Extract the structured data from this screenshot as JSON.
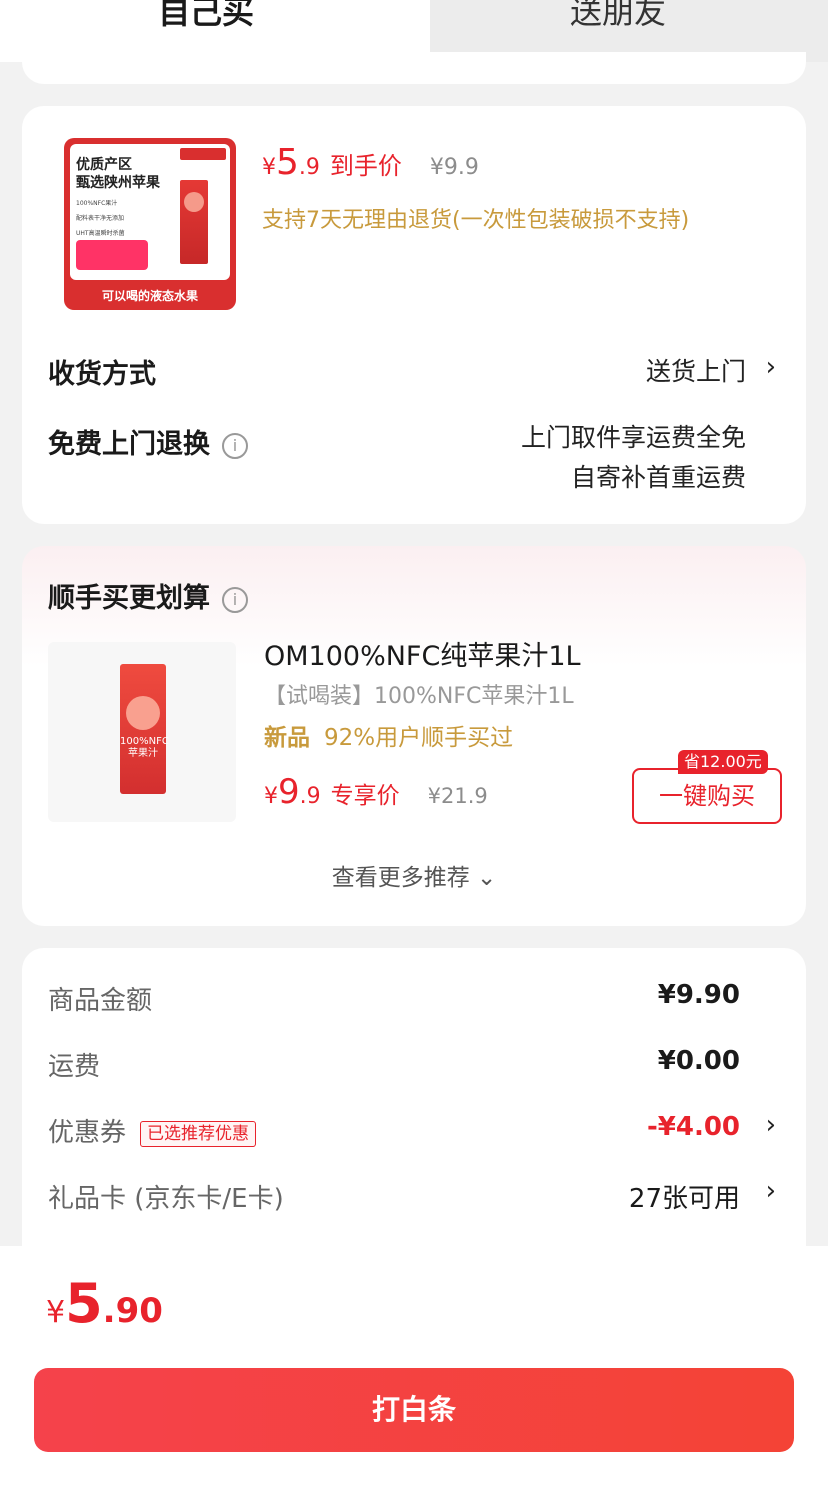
{
  "tabs": {
    "self": "自己买",
    "gift": "送朋友"
  },
  "product": {
    "thumb_title_1": "优质产区",
    "thumb_title_2": "甄选陕州苹果",
    "thumb_list": [
      "100%NFC果汁",
      "配料表干净无添加",
      "UHT高温瞬时杀菌"
    ],
    "thumb_caption": "可以喝的液态水果",
    "price_yen": "¥",
    "price_int": "5",
    "price_dec": ".9",
    "price_tag": "到手价",
    "orig_price": "¥9.9",
    "return_note": "支持7天无理由退货(一次性包装破损不支持)"
  },
  "delivery": {
    "label": "收货方式",
    "value": "送货上门"
  },
  "exchange": {
    "label": "免费上门退换",
    "line1": "上门取件享运费全免",
    "line2": "自寄补首重运费"
  },
  "recommend": {
    "title": "顺手买更划算",
    "name": "OM100%NFC纯苹果汁1L",
    "sub": "【试喝装】100%NFC苹果汁1L",
    "new_tag": "新品",
    "stat": "92%用户顺手买过",
    "price_yen": "¥",
    "price_int": "9",
    "price_dec": ".9",
    "price_tag": "专享价",
    "orig_price": "¥21.9",
    "save_badge": "省12.00元",
    "buy_label": "一键购买",
    "more": "查看更多推荐",
    "box_text": "100%NFC 苹果汁"
  },
  "summary": {
    "goods_label": "商品金额",
    "goods_value": "¥9.90",
    "shipping_label": "运费",
    "shipping_value": "¥0.00",
    "coupon_label": "优惠券",
    "coupon_tag": "已选推荐优惠",
    "coupon_value": "-¥4.00",
    "giftcard_label": "礼品卡 (京东卡/E卡)",
    "giftcard_value": "27张可用"
  },
  "footer": {
    "total_yen": "¥",
    "total_int": "5",
    "total_dec": ".90",
    "pay_label": "打白条"
  },
  "colors": {
    "accent": "#e8232c",
    "gold": "#c89a3c"
  }
}
